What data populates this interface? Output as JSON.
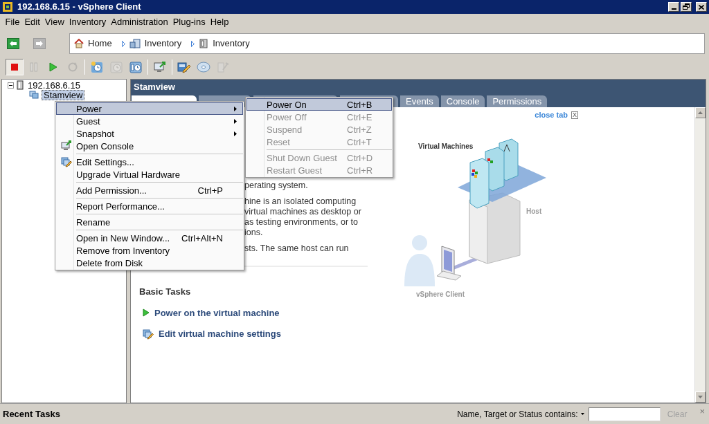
{
  "window": {
    "title": "192.168.6.15 - vSphere Client"
  },
  "menu_bar": [
    "File",
    "Edit",
    "View",
    "Inventory",
    "Administration",
    "Plug-ins",
    "Help"
  ],
  "navigation": {
    "back": {
      "disabled": false
    },
    "forward": {
      "disabled": true
    }
  },
  "breadcrumb": [
    {
      "label": "Home",
      "kind": "home"
    },
    {
      "label": "Inventory",
      "kind": "hosts"
    },
    {
      "label": "Inventory",
      "kind": "vms"
    }
  ],
  "toolbar": [
    {
      "kind": "stop",
      "disabled": false,
      "selected": true
    },
    {
      "kind": "pause",
      "disabled": true,
      "selected": false
    },
    {
      "kind": "play",
      "disabled": false,
      "selected": false
    },
    {
      "kind": "reset",
      "disabled": true,
      "selected": false
    },
    {
      "kind": "separator"
    },
    {
      "kind": "snapshot",
      "disabled": false,
      "selected": false
    },
    {
      "kind": "revert",
      "disabled": true,
      "selected": false
    },
    {
      "kind": "manager",
      "disabled": false,
      "selected": false
    },
    {
      "kind": "separator"
    },
    {
      "kind": "console",
      "disabled": false,
      "selected": false
    },
    {
      "kind": "separator"
    },
    {
      "kind": "edit",
      "disabled": false,
      "selected": false
    },
    {
      "kind": "disc",
      "disabled": false,
      "selected": false
    },
    {
      "kind": "tools",
      "disabled": true,
      "selected": false
    }
  ],
  "tree": [
    {
      "label": "192.168.6.15",
      "kind": "host",
      "expanded": true,
      "selected": false,
      "children": [
        {
          "label": "Stamview",
          "kind": "vm",
          "selected": true
        }
      ]
    }
  ],
  "panel": {
    "title": "Stamview",
    "tabs": [
      {
        "selected": true
      },
      {
        "selected": false
      },
      {
        "selected": false
      },
      {
        "selected": false
      },
      {
        "label": "Events",
        "selected": false
      },
      {
        "label": "Console",
        "selected": false
      },
      {
        "label": "Permissions",
        "selected": false
      }
    ],
    "close_tab": {
      "label": "close tab",
      "close": "X"
    },
    "paragraphs": [
      [
        "perating system."
      ],
      [
        "hine is an isolated computing",
        "virtual machines as desktop or",
        "as testing environments, or to",
        "ions."
      ],
      [
        "sts. The same host can run"
      ]
    ],
    "basic_tasks": {
      "title": "Basic Tasks",
      "items": [
        {
          "label": "Power on the virtual machine",
          "kind": "power"
        },
        {
          "label": "Edit virtual machine settings",
          "kind": "edit"
        }
      ]
    },
    "diagram": {
      "vms_label": "Virtual Machines",
      "host_label": "Host",
      "client_label": "vSphere Client"
    }
  },
  "context_menu": [
    {
      "kind": "item",
      "label": "Power",
      "submenu": true,
      "selected": true
    },
    {
      "kind": "item",
      "label": "Guest",
      "submenu": true,
      "selected": false
    },
    {
      "kind": "item",
      "label": "Snapshot",
      "submenu": true,
      "selected": false
    },
    {
      "kind": "console",
      "label": "Open Console",
      "selected": false
    },
    {
      "kind": "separator"
    },
    {
      "kind": "edit",
      "label": "Edit Settings...",
      "selected": false
    },
    {
      "kind": "item",
      "label": "Upgrade Virtual Hardware",
      "selected": false
    },
    {
      "kind": "separator"
    },
    {
      "kind": "item",
      "label": "Add Permission...",
      "shortcut": "Ctrl+P",
      "selected": false
    },
    {
      "kind": "separator"
    },
    {
      "kind": "item",
      "label": "Report Performance...",
      "selected": false
    },
    {
      "kind": "separator"
    },
    {
      "kind": "item",
      "label": "Rename",
      "selected": false
    },
    {
      "kind": "separator"
    },
    {
      "kind": "item",
      "label": "Open in New Window...",
      "shortcut": "Ctrl+Alt+N",
      "selected": false
    },
    {
      "kind": "item",
      "label": "Remove from Inventory",
      "selected": false
    },
    {
      "kind": "item",
      "label": "Delete from Disk",
      "selected": false
    }
  ],
  "power_submenu": [
    {
      "kind": "item",
      "label": "Power On",
      "shortcut": "Ctrl+B",
      "selected": true,
      "disabled": false
    },
    {
      "kind": "item",
      "label": "Power Off",
      "shortcut": "Ctrl+E",
      "selected": false,
      "disabled": true
    },
    {
      "kind": "item",
      "label": "Suspend",
      "shortcut": "Ctrl+Z",
      "selected": false,
      "disabled": true
    },
    {
      "kind": "item",
      "label": "Reset",
      "shortcut": "Ctrl+T",
      "selected": false,
      "disabled": true
    },
    {
      "kind": "separator"
    },
    {
      "kind": "item",
      "label": "Shut Down Guest",
      "shortcut": "Ctrl+D",
      "selected": false,
      "disabled": true
    },
    {
      "kind": "item",
      "label": "Restart Guest",
      "shortcut": "Ctrl+R",
      "selected": false,
      "disabled": true
    }
  ],
  "status_bar": {
    "title": "Recent Tasks",
    "filter_label": "Name, Target or Status contains:",
    "clear": {
      "label": "Clear",
      "disabled": true
    },
    "close": "×"
  }
}
